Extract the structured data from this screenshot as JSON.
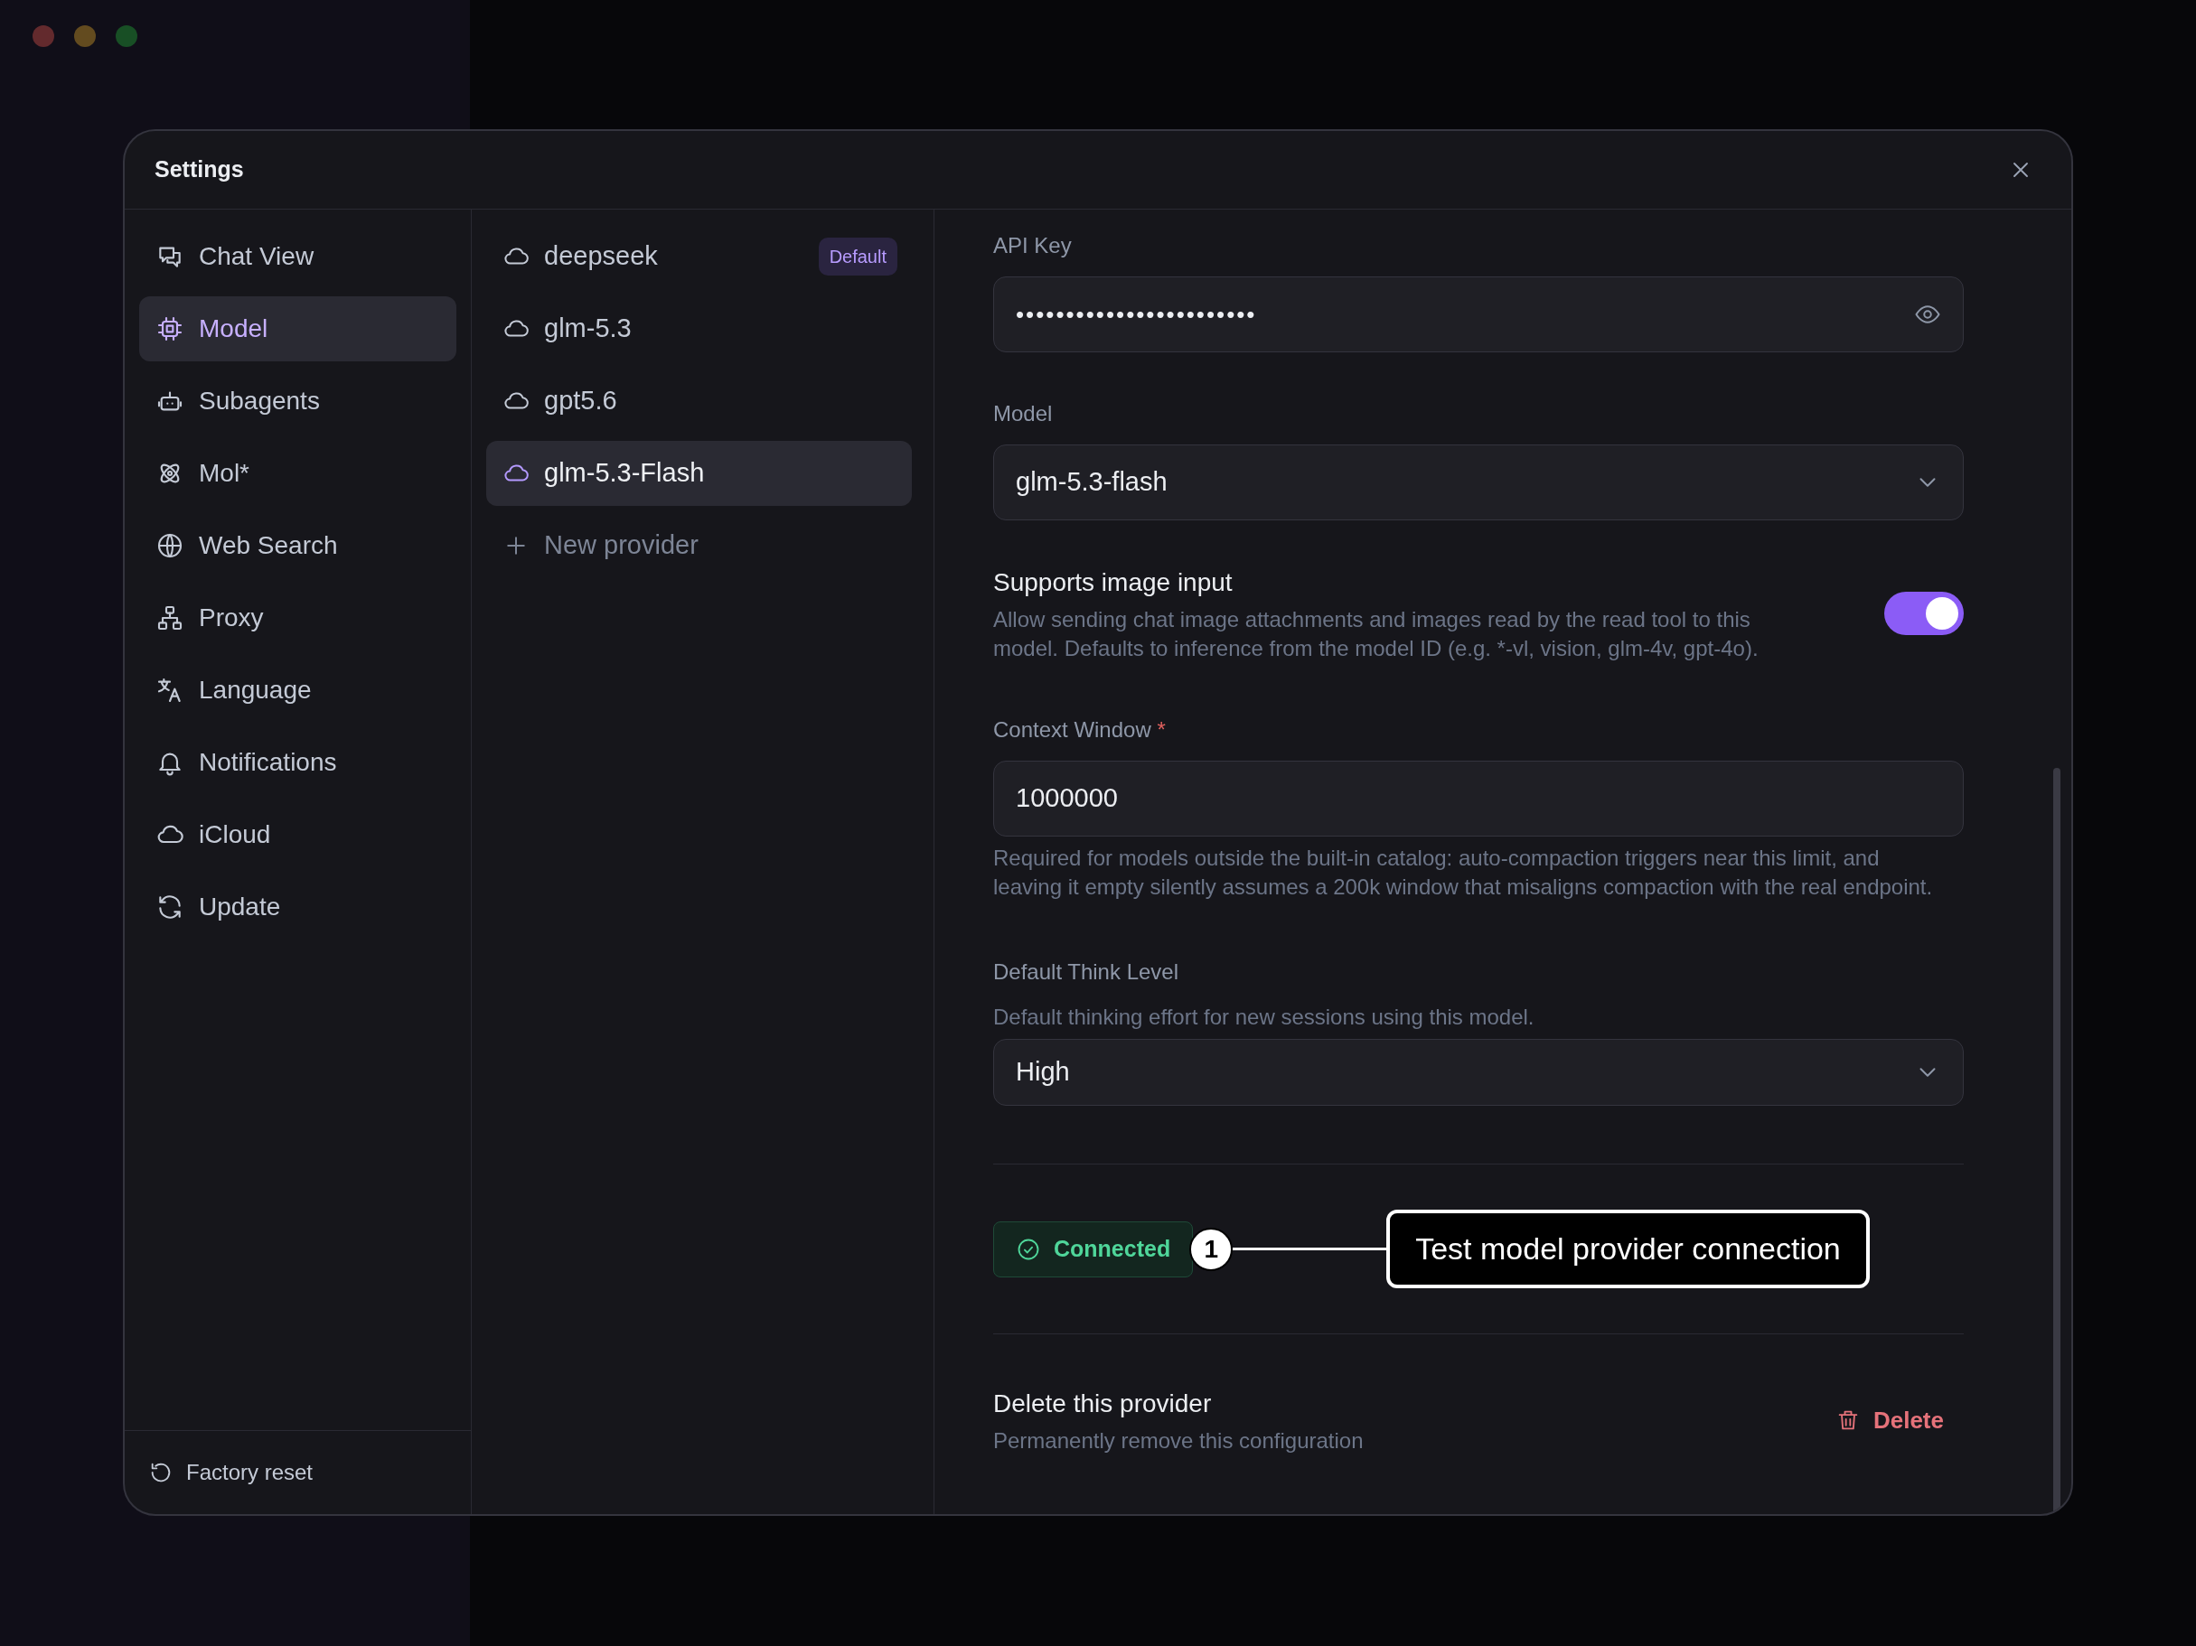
{
  "dialog": {
    "title": "Settings"
  },
  "nav": {
    "items": [
      {
        "label": "Chat View",
        "selected": false
      },
      {
        "label": "Model",
        "selected": true
      },
      {
        "label": "Subagents",
        "selected": false
      },
      {
        "label": "Mol*",
        "selected": false
      },
      {
        "label": "Web Search",
        "selected": false
      },
      {
        "label": "Proxy",
        "selected": false
      },
      {
        "label": "Language",
        "selected": false
      },
      {
        "label": "Notifications",
        "selected": false
      },
      {
        "label": "iCloud",
        "selected": false
      },
      {
        "label": "Update",
        "selected": false
      }
    ],
    "footer": {
      "label": "Factory reset"
    }
  },
  "providers": {
    "items": [
      {
        "name": "deepseek",
        "badge": "Default",
        "selected": false
      },
      {
        "name": "glm-5.3",
        "selected": false
      },
      {
        "name": "gpt5.6",
        "selected": false
      },
      {
        "name": "glm-5.3-Flash",
        "selected": true
      }
    ],
    "add": {
      "label": "New provider"
    }
  },
  "form": {
    "api_key": {
      "label": "API Key",
      "value": "••••••••••••••••••••••••"
    },
    "model": {
      "label": "Model",
      "value": "glm-5.3-flash"
    },
    "image_input": {
      "title": "Supports image input",
      "description": "Allow sending chat image attachments and images read by the read tool to this model. Defaults to inference from the model ID (e.g. *-vl, vision, glm-4v, gpt-4o).",
      "on": true
    },
    "context_window": {
      "label": "Context Window",
      "required_mark": "*",
      "value": "1000000",
      "help": "Required for models outside the built-in catalog: auto-compaction triggers near this limit, and leaving it empty silently assumes a 200k window that misaligns compaction with the real endpoint."
    },
    "think_level": {
      "label": "Default Think Level",
      "description": "Default thinking effort for new sessions using this model.",
      "value": "High"
    },
    "connection": {
      "status": "Connected"
    },
    "callout": {
      "number": "1",
      "text": "Test model provider connection"
    },
    "delete": {
      "title": "Delete this provider",
      "description": "Permanently remove this configuration",
      "button": "Delete"
    }
  }
}
